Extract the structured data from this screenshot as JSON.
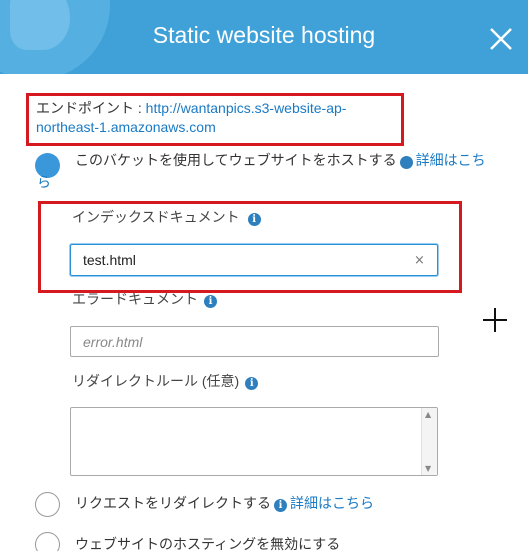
{
  "dialog": {
    "title": "Static website hosting"
  },
  "endpoint": {
    "label": "エンドポイント : ",
    "url": "http://wantanpics.s3-website-ap-northeast-1.amazonaws.com"
  },
  "options": {
    "host_website": {
      "label": "このバケットを使用してウェブサイトをホストする",
      "learn_more": "詳細はこちら",
      "selected": true
    },
    "redirect_requests": {
      "label": "リクエストをリダイレクトする",
      "learn_more": "詳細はこちら",
      "selected": false
    },
    "disable_hosting": {
      "label": "ウェブサイトのホスティングを無効にする",
      "selected": false
    }
  },
  "fields": {
    "index_document": {
      "label": "インデックスドキュメント",
      "value": "test.html"
    },
    "error_document": {
      "label": "エラードキュメント",
      "placeholder": "error.html"
    },
    "redirect_rules": {
      "label": "リダイレクトルール (任意)"
    }
  },
  "icons": {
    "info": "i",
    "clear": "×"
  },
  "colors": {
    "header": "#3fa1d8",
    "highlight": "#d6191f",
    "link": "#1a7ac4",
    "radio_selected": "#3a97d9"
  }
}
